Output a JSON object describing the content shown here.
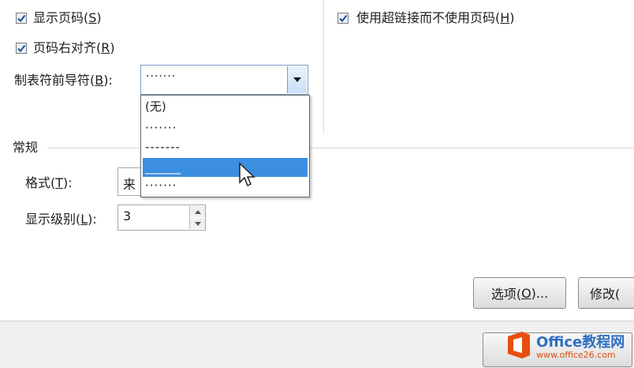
{
  "options": {
    "show_page_numbers": {
      "label": "显示页码(",
      "key": "S",
      "suffix": ")",
      "checked": true
    },
    "right_align": {
      "label": "页码右对齐(",
      "key": "R",
      "suffix": ")",
      "checked": true
    },
    "use_hyperlinks": {
      "label": "使用超链接而不使用页码(",
      "key": "H",
      "suffix": ")",
      "checked": true
    }
  },
  "tab_leader": {
    "label": "制表符前导符(",
    "key": "B",
    "suffix": "):",
    "value": "·······",
    "dropdown_options": [
      "(无)",
      "·······",
      "-------",
      "______",
      "·······"
    ],
    "selected_index": 3
  },
  "general": {
    "title": "常规",
    "format": {
      "label": "格式(",
      "key": "T",
      "suffix": "):",
      "value": "来"
    },
    "levels": {
      "label": "显示级别(",
      "key": "L",
      "suffix": "):",
      "value": "3"
    }
  },
  "buttons": {
    "options": {
      "label": "选项(",
      "key": "O",
      "suffix": ")..."
    },
    "modify": {
      "label": "修改("
    }
  },
  "watermark": {
    "brand": "Office教程网",
    "url": "www.office26.com"
  },
  "colors": {
    "selection": "#3c8ee0",
    "accent": "#2f6fc0",
    "logo_orange": "#e84e0e"
  }
}
